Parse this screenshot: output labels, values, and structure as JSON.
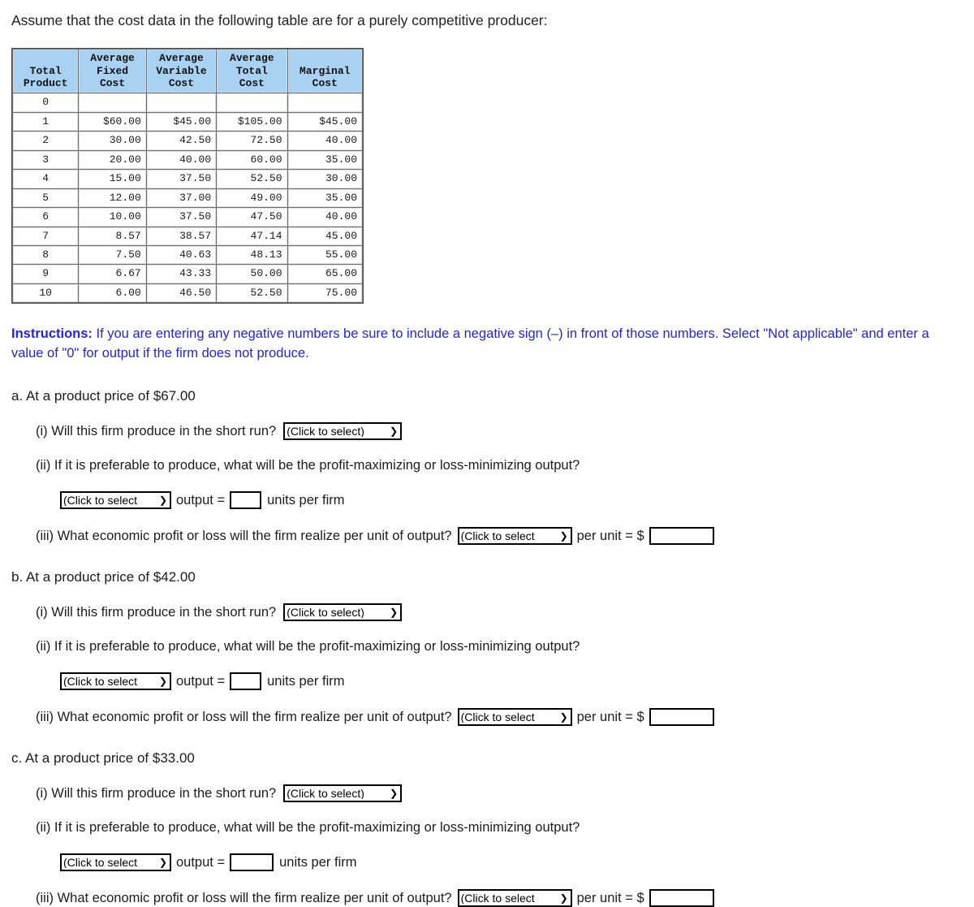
{
  "intro": "Assume that the cost data in the following table are for a purely competitive producer:",
  "cost_table": {
    "headers": [
      "Total\nProduct",
      "Average\nFixed\nCost",
      "Average\nVariable\nCost",
      "Average\nTotal\nCost",
      "Marginal\nCost"
    ],
    "header_lines": [
      [
        "Total",
        "Product"
      ],
      [
        "Average",
        "Fixed",
        "Cost"
      ],
      [
        "Average",
        "Variable",
        "Cost"
      ],
      [
        "Average",
        "Total",
        "Cost"
      ],
      [
        "Marginal",
        "Cost"
      ]
    ],
    "rows": [
      {
        "total_product": "0",
        "afc": "",
        "avc": "",
        "atc": "",
        "mc": ""
      },
      {
        "total_product": "1",
        "afc": "$60.00",
        "avc": "$45.00",
        "atc": "$105.00",
        "mc": "$45.00"
      },
      {
        "total_product": "2",
        "afc": "30.00",
        "avc": "42.50",
        "atc": "72.50",
        "mc": "40.00"
      },
      {
        "total_product": "3",
        "afc": "20.00",
        "avc": "40.00",
        "atc": "60.00",
        "mc": "35.00"
      },
      {
        "total_product": "4",
        "afc": "15.00",
        "avc": "37.50",
        "atc": "52.50",
        "mc": "30.00"
      },
      {
        "total_product": "5",
        "afc": "12.00",
        "avc": "37.00",
        "atc": "49.00",
        "mc": "35.00"
      },
      {
        "total_product": "6",
        "afc": "10.00",
        "avc": "37.50",
        "atc": "47.50",
        "mc": "40.00"
      },
      {
        "total_product": "7",
        "afc": "8.57",
        "avc": "38.57",
        "atc": "47.14",
        "mc": "45.00"
      },
      {
        "total_product": "8",
        "afc": "7.50",
        "avc": "40.63",
        "atc": "48.13",
        "mc": "55.00"
      },
      {
        "total_product": "9",
        "afc": "6.67",
        "avc": "43.33",
        "atc": "50.00",
        "mc": "65.00"
      },
      {
        "total_product": "10",
        "afc": "6.00",
        "avc": "46.50",
        "atc": "52.50",
        "mc": "75.00"
      }
    ]
  },
  "instructions": {
    "label": "Instructions:",
    "text": " If you are entering any negative numbers be sure to include a negative sign (–) in front of those numbers. Select \"Not applicable\" and enter a value of \"0\" for output if the firm does not produce.",
    "color": "#2222ee"
  },
  "parts": [
    {
      "heading": "a. At a product price of $67.00",
      "q1": {
        "text": "(i) Will this firm produce in the short run?",
        "select_value": "(Click to select)",
        "select_caret": "⌄"
      },
      "q2": {
        "text": "(ii) If it is preferable to produce, what will be the profit-maximizing or loss-minimizing output?",
        "select_value": "(Click to select",
        "output_label": "output =",
        "input_value": "",
        "units_label": "units per firm"
      },
      "q3": {
        "text": "(iii) What economic profit or loss will the firm realize per unit of output?",
        "select_value": "(Click to select",
        "per_unit_label": "per unit = $",
        "input_value": ""
      }
    },
    {
      "heading": "b. At a product price of $42.00",
      "q1": {
        "text": "(i) Will this firm produce in the short run?",
        "select_value": "(Click to select)",
        "select_caret": "⌄"
      },
      "q2": {
        "text": "(ii) If it is preferable to produce, what will be the profit-maximizing or loss-minimizing output?",
        "select_value": "(Click to select",
        "output_label": "output =",
        "input_value": "",
        "units_label": "units per firm"
      },
      "q3": {
        "text": "(iii) What economic profit or loss will the firm realize per unit of output?",
        "select_value": "(Click to select",
        "per_unit_label": "per unit = $",
        "input_value": ""
      }
    },
    {
      "heading": "c. At a product price of $33.00",
      "q1": {
        "text": "(i) Will this firm produce in the short run?",
        "select_value": "(Click to select)",
        "select_caret": "⌄"
      },
      "q2": {
        "text": "(ii) If it is preferable to produce, what will be the profit-maximizing or loss-minimizing output?",
        "select_value": "(Click to select",
        "output_label": "output =",
        "input_value": "",
        "units_label": "units per firm"
      },
      "q3": {
        "text": "(iii) What economic profit or loss will the firm realize per unit of output?",
        "select_value": "(Click to select",
        "per_unit_label": "per unit = $",
        "input_value": ""
      }
    }
  ]
}
